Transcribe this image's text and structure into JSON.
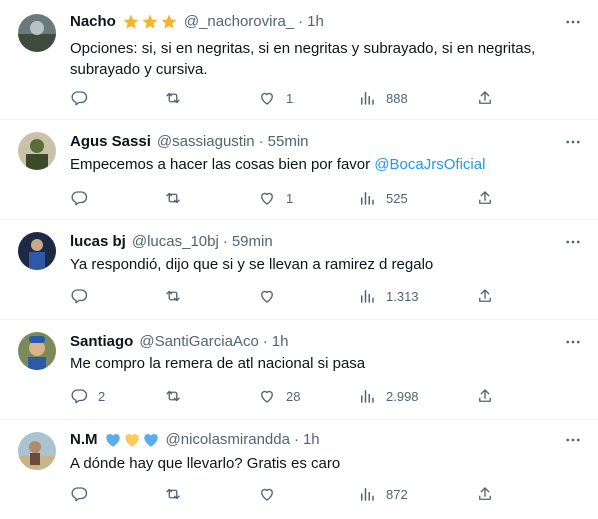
{
  "replies": [
    {
      "name": "Nacho",
      "handle": "@_nachorovira_",
      "time": "1h",
      "emoji": [
        "star-emoji",
        "star-emoji",
        "star-emoji"
      ],
      "text": "Opciones: si, si en negritas, si en negritas y subrayado, si en negritas, subrayado y cursiva.",
      "replies": "",
      "retweets": "",
      "likes": "1",
      "views": "888",
      "avatar_color": "#4a5a4a"
    },
    {
      "name": "Agus Sassi",
      "handle": "@sassiagustin",
      "time": "55min",
      "text": "Empecemos a hacer las cosas bien por favor",
      "mention": "@BocaJrsOficial",
      "replies": "",
      "retweets": "",
      "likes": "1",
      "views": "525",
      "avatar_color": "#5c6b3a"
    },
    {
      "name": "lucas bj",
      "handle": "@lucas_10bj",
      "time": "59min",
      "text": "Ya respondió, dijo que si y se llevan a ramirez d regalo",
      "replies": "",
      "retweets": "",
      "likes": "",
      "views": "1.313",
      "avatar_color": "#2a3b6a"
    },
    {
      "name": "Santiago",
      "handle": "@SantiGarciaAco",
      "time": "1h",
      "text": "Me compro la remera de atl nacional si pasa",
      "replies": "2",
      "retweets": "",
      "likes": "28",
      "views": "2.998",
      "avatar_color": "#6b5a3a"
    },
    {
      "name": "N.M",
      "handle": "@nicolasmirandda",
      "time": "1h",
      "emoji": [
        "blue-heart-emoji",
        "yellow-heart-emoji",
        "blue-heart-emoji"
      ],
      "text": "A dónde hay que llevarlo? Gratis es caro",
      "replies": "",
      "retweets": "",
      "likes": "",
      "views": "872",
      "avatar_color": "#8aa0a8"
    }
  ],
  "colors": {
    "text": "#0f1419",
    "secondary": "#536471",
    "link": "#1d9bf0",
    "star": "#f6b62b",
    "heart_blue": "#5dadec",
    "heart_yellow": "#fdcb58"
  }
}
